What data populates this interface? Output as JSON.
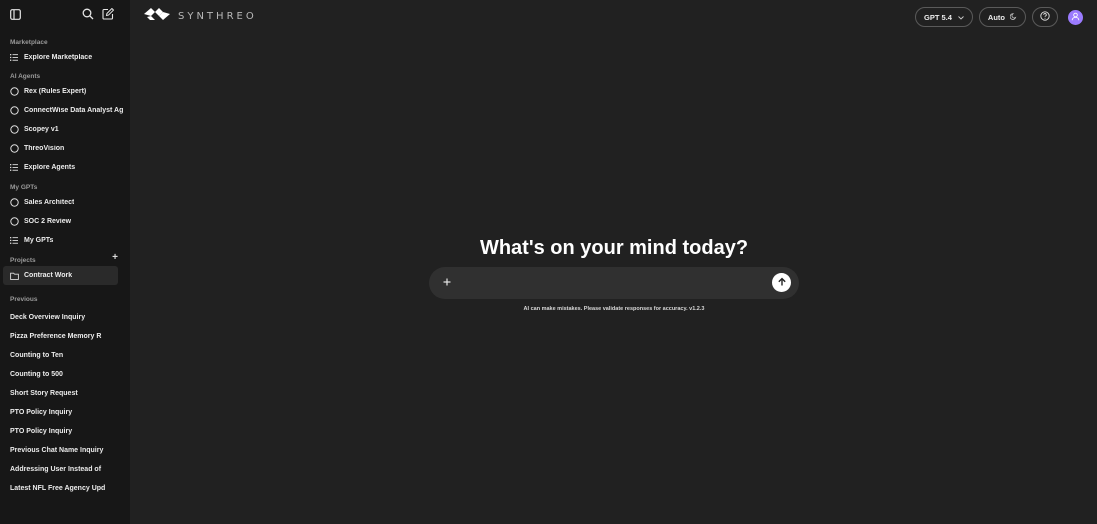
{
  "brand": {
    "name": "SYNTHREO"
  },
  "header": {
    "model_label": "GPT 5.4",
    "theme_label": "Auto"
  },
  "sidebar": {
    "marketplace": {
      "label": "Marketplace",
      "items": [
        {
          "label": "Explore Marketplace",
          "icon": "list-icon"
        }
      ]
    },
    "agents": {
      "label": "AI Agents",
      "items": [
        {
          "label": "Rex (Rules Expert)",
          "icon": "circle-icon"
        },
        {
          "label": "ConnectWise Data Analyst Ag",
          "icon": "circle-icon"
        },
        {
          "label": "Scopey v1",
          "icon": "circle-icon"
        },
        {
          "label": "ThreoVision",
          "icon": "circle-icon"
        },
        {
          "label": "Explore Agents",
          "icon": "list-icon"
        }
      ]
    },
    "gpts": {
      "label": "My GPTs",
      "items": [
        {
          "label": "Sales Architect",
          "icon": "circle-icon"
        },
        {
          "label": "SOC 2 Review",
          "icon": "circle-icon"
        },
        {
          "label": "My GPTs",
          "icon": "list-icon"
        }
      ]
    },
    "projects": {
      "label": "Projects",
      "items": [
        {
          "label": "Contract Work",
          "icon": "folder-icon"
        }
      ]
    },
    "previous": {
      "label": "Previous",
      "items": [
        "Deck Overview Inquiry",
        "Pizza Preference Memory R",
        "Counting to Ten",
        "Counting to 500",
        "Short Story Request",
        "PTO Policy Inquiry",
        "PTO Policy Inquiry",
        "Previous Chat Name Inquiry",
        "Addressing User Instead of",
        "Latest NFL Free Agency Upd"
      ]
    }
  },
  "main": {
    "headline": "What's on your mind today?",
    "input_placeholder": "",
    "disclaimer": "AI can make mistakes. Please validate responses for accuracy. v1.2.3"
  }
}
